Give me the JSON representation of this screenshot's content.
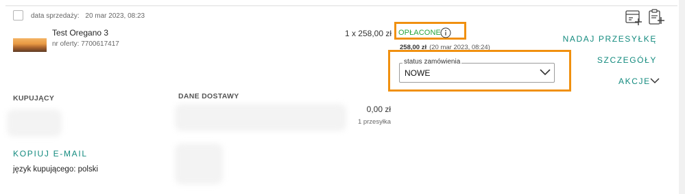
{
  "order": {
    "sale_date_label": "data sprzedaży:",
    "sale_date_value": "20 mar 2023, 08:23"
  },
  "product": {
    "name": "Test Oregano 3",
    "offer_number": "nr oferty: 7700617417",
    "quantity_price": "1 x 258,00 zł"
  },
  "payment": {
    "status": "OPŁACONE",
    "amount": "258,00 zł",
    "date": "(20 mar 2023, 08:24)"
  },
  "status_select": {
    "label": "status zamówienia",
    "value": "NOWE"
  },
  "actions": {
    "send_shipment": "NADAJ PRZESYŁKĘ",
    "details": "SZCZEGÓŁY",
    "actions_menu": "AKCJE"
  },
  "buyer": {
    "header": "KUPUJĄCY",
    "copy_email": "KOPIUJ E-MAIL",
    "language": "język kupującego: polski"
  },
  "delivery": {
    "header": "DANE DOSTAWY",
    "cost": "0,00 zł",
    "packages": "1 przesyłka"
  },
  "colors": {
    "accent": "#128a7e",
    "paid": "#25a53b",
    "highlight": "#f0900f"
  }
}
